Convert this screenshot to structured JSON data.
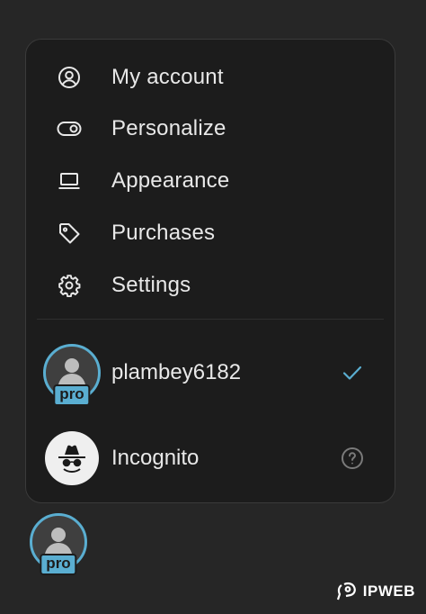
{
  "menu": {
    "items": [
      {
        "label": "My account",
        "icon": "user-circle-icon"
      },
      {
        "label": "Personalize",
        "icon": "toggle-icon"
      },
      {
        "label": "Appearance",
        "icon": "laptop-icon"
      },
      {
        "label": "Purchases",
        "icon": "tag-icon"
      },
      {
        "label": "Settings",
        "icon": "gear-icon"
      }
    ]
  },
  "accounts": {
    "current": {
      "username": "plambey6182",
      "badge": "pro",
      "selected": true
    },
    "incognito": {
      "label": "Incognito"
    }
  },
  "profile_button": {
    "badge": "pro"
  },
  "watermark": {
    "text": "IPWEB"
  },
  "colors": {
    "accent": "#5aaed1",
    "menu_bg": "#1c1c1c",
    "page_bg": "#262626",
    "text": "#e8e8e8"
  }
}
